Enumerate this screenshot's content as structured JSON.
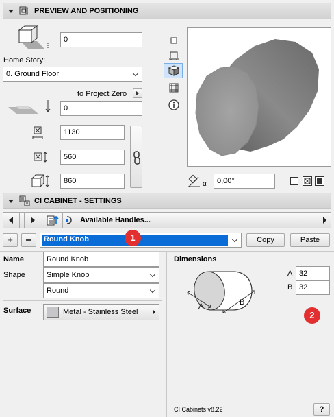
{
  "preview_section": {
    "title": "PREVIEW AND POSITIONING",
    "elevation_value": "0",
    "home_story_label": "Home Story:",
    "home_story_value": "0. Ground Floor",
    "project_zero_label": "to Project Zero",
    "project_zero_value": "0",
    "dim_x": "1130",
    "dim_y": "560",
    "dim_z": "860",
    "angle_value": "0,00°",
    "angle_symbol": "α"
  },
  "settings_section": {
    "title": "CI CABINET - SETTINGS",
    "handles_label": "Available Handles...",
    "selected_item": "Round Knob",
    "copy_label": "Copy",
    "paste_label": "Paste",
    "name_label": "Name",
    "name_value": "Round Knob",
    "shape_label": "Shape",
    "shape_value": "Simple Knob",
    "shape_sub_value": "Round",
    "surface_label": "Surface",
    "surface_value": "Metal - Stainless Steel",
    "surface_color": "#c6c6c8",
    "dimensions_label": "Dimensions",
    "dim_a_label": "A",
    "dim_a_value": "32",
    "dim_b_label": "B",
    "dim_b_value": "32",
    "diagram_a": "A",
    "diagram_b": "B",
    "version": "CI Cabinets v8.22",
    "help": "?"
  },
  "callouts": {
    "one": "1",
    "two": "2"
  },
  "colors": {
    "accent": "#0a6cd6",
    "badge": "#e32f2f"
  }
}
